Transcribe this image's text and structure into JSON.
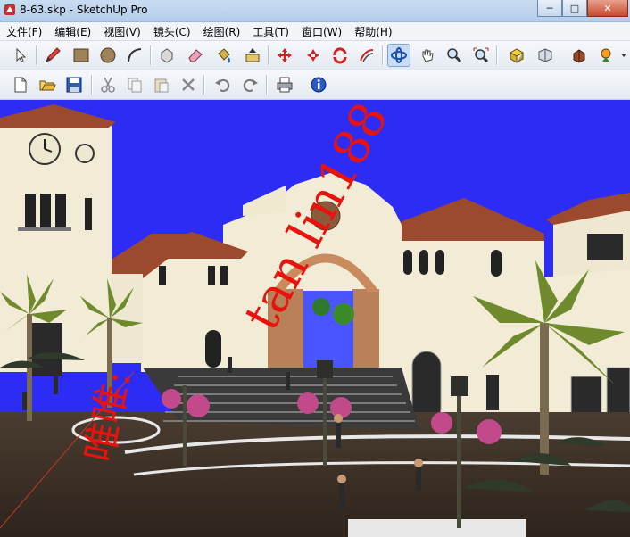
{
  "window": {
    "title": "8-63.skp - SketchUp Pro",
    "minimize_label": "─",
    "maximize_label": "□",
    "close_label": "✕"
  },
  "menu": [
    "文件(F)",
    "编辑(E)",
    "视图(V)",
    "镜头(C)",
    "绘图(R)",
    "工具(T)",
    "窗口(W)",
    "帮助(H)"
  ],
  "toolbar_row1": [
    "select-icon",
    "pencil-icon",
    "rectangle-icon",
    "circle-icon",
    "arc-icon",
    "make-component-icon",
    "eraser-icon",
    "paint-bucket-icon",
    "push-pull-icon",
    "move-icon",
    "rotate-icon",
    "follow-me-icon",
    "offset-icon",
    "orbit-icon",
    "pan-icon",
    "zoom-icon",
    "zoom-extents-icon",
    "get-models-icon",
    "share-model-icon",
    "component-icon",
    "extension-icon"
  ],
  "toolbar_row2": [
    "new-file-icon",
    "open-file-icon",
    "save-icon",
    "cut-icon",
    "copy-icon",
    "paste-icon",
    "delete-icon",
    "undo-icon",
    "redo-icon",
    "print-icon",
    "model-info-icon"
  ],
  "watermark": {
    "vertical_text": "唯唯:",
    "diagonal_text": "tan lin188"
  },
  "colors": {
    "viewport_background": "#2d2cf5",
    "building_cream": "#f2ecd6",
    "roof_terracotta": "#9c4a2e",
    "watermark_red": "#e8130d"
  }
}
